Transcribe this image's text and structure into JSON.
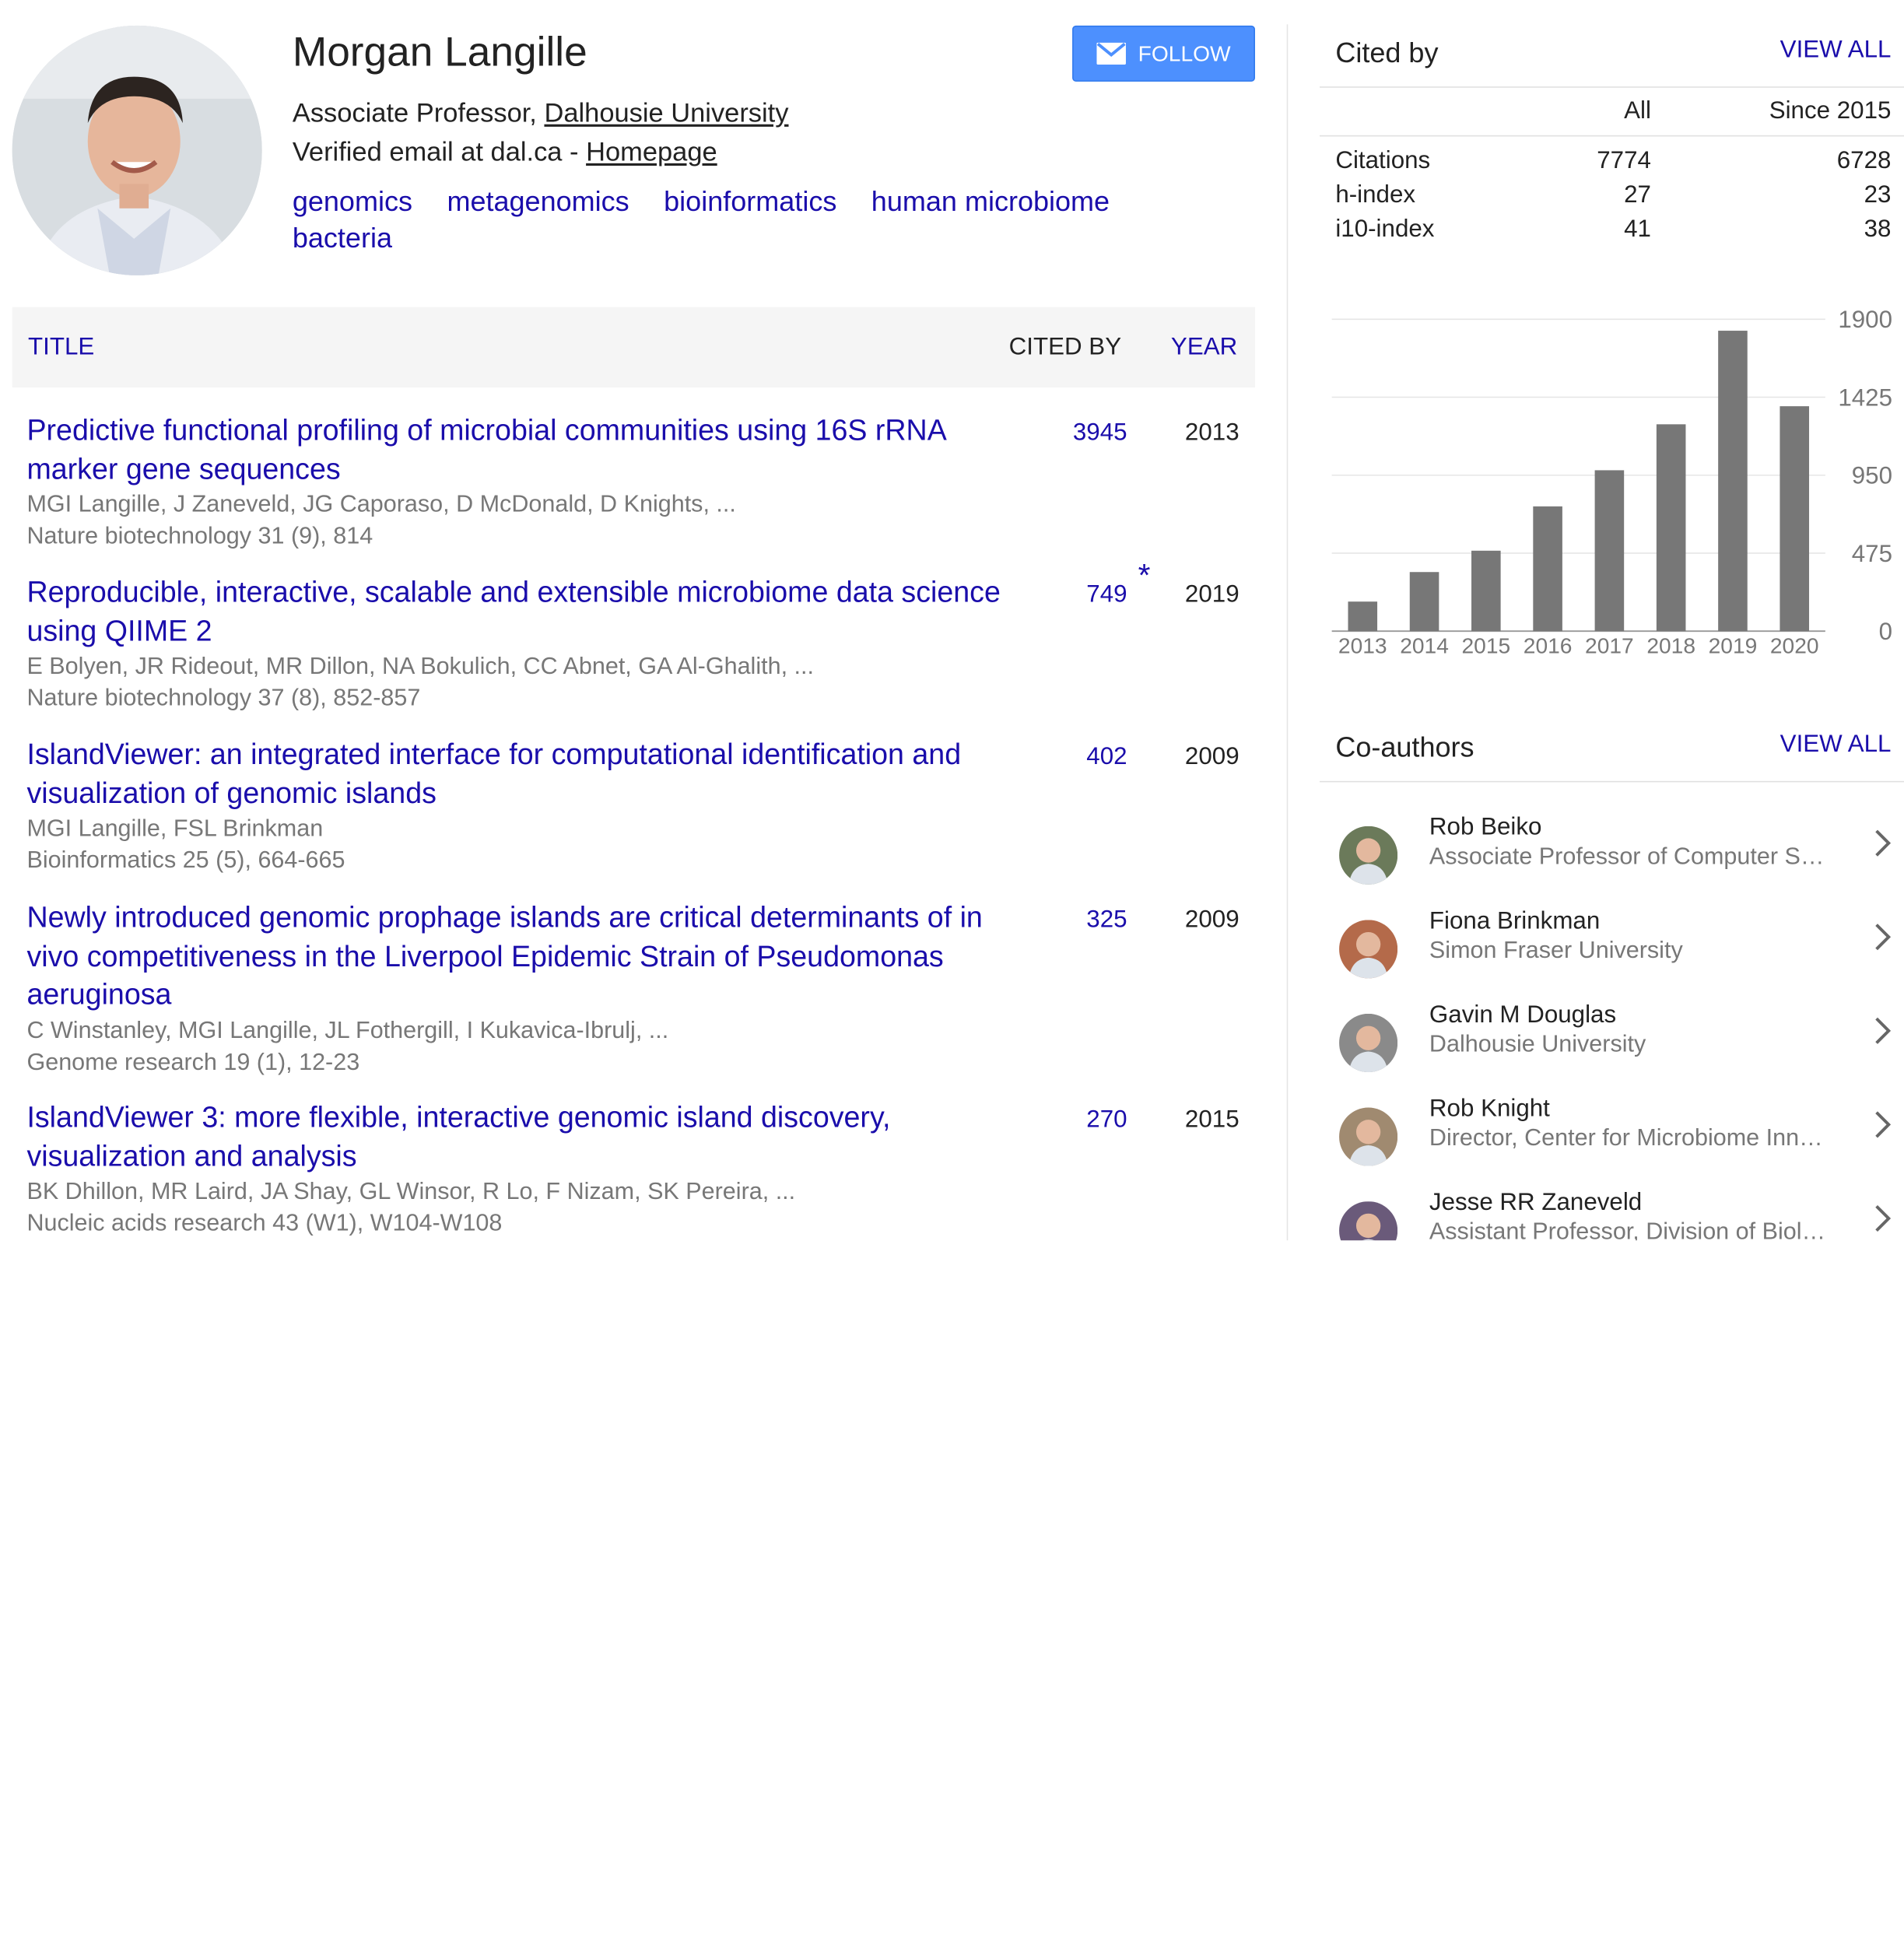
{
  "profile": {
    "name": "Morgan Langille",
    "position": "Associate Professor, ",
    "university": "Dalhousie University",
    "email_text": "Verified email at dal.ca - ",
    "homepage": "Homepage",
    "interests": [
      "genomics",
      "metagenomics",
      "bioinformatics",
      "human microbiome",
      "bacteria"
    ],
    "follow_label": "FOLLOW",
    "avatar_icon": "person-photo-icon"
  },
  "table": {
    "headers": {
      "title": "TITLE",
      "cited_by": "CITED BY",
      "year": "YEAR"
    },
    "rows": [
      {
        "title": "Predictive functional profiling of microbial communities using 16S rRNA marker gene sequences",
        "authors": "MGI Langille, J Zaneveld, JG Caporaso, D McDonald, D Knights, ...",
        "venue": "Nature biotechnology 31 (9), 814",
        "cited": "3945",
        "star": "",
        "year": "2013"
      },
      {
        "title": "Reproducible, interactive, scalable and extensible microbiome data science using QIIME 2",
        "authors": "E Bolyen, JR Rideout, MR Dillon, NA Bokulich, CC Abnet, GA Al-Ghalith, ...",
        "venue": "Nature biotechnology 37 (8), 852-857",
        "cited": "749",
        "star": "*",
        "year": "2019"
      },
      {
        "title": "IslandViewer: an integrated interface for computational identification and visualization of genomic islands",
        "authors": "MGI Langille, FSL Brinkman",
        "venue": "Bioinformatics 25 (5), 664-665",
        "cited": "402",
        "star": "",
        "year": "2009"
      },
      {
        "title": "Newly introduced genomic prophage islands are critical determinants of in vivo competitiveness in the Liverpool Epidemic Strain of Pseudomonas aeruginosa",
        "authors": "C Winstanley, MGI Langille, JL Fothergill, I Kukavica-Ibrulj, ...",
        "venue": "Genome research 19 (1), 12-23",
        "cited": "325",
        "star": "",
        "year": "2009"
      },
      {
        "title": "IslandViewer 3: more flexible, interactive genomic island discovery, visualization and analysis",
        "authors": "BK Dhillon, MR Laird, JA Shay, GL Winsor, R Lo, F Nizam, SK Pereira, ...",
        "venue": "Nucleic acids research 43 (W1), W104-W108",
        "cited": "270",
        "star": "",
        "year": "2015"
      }
    ]
  },
  "cited_by": {
    "title": "Cited by",
    "view_all": "VIEW ALL",
    "col_all": "All",
    "col_since": "Since 2015",
    "rows": [
      {
        "label": "Citations",
        "all": "7774",
        "since": "6728"
      },
      {
        "label": "h-index",
        "all": "27",
        "since": "23"
      },
      {
        "label": "i10-index",
        "all": "41",
        "since": "38"
      }
    ]
  },
  "chart_data": {
    "type": "bar",
    "categories": [
      "2013",
      "2014",
      "2015",
      "2016",
      "2017",
      "2018",
      "2019",
      "2020"
    ],
    "values": [
      180,
      360,
      490,
      760,
      980,
      1260,
      1830,
      1370
    ],
    "y_ticks": [
      "0",
      "475",
      "950",
      "1425",
      "1900"
    ],
    "ylim": [
      0,
      1900
    ],
    "bar_color": "#777777",
    "grid": true
  },
  "coauthors": {
    "title": "Co-authors",
    "view_all": "VIEW ALL",
    "items": [
      {
        "name": "Rob Beiko",
        "affiliation": "Associate Professor of Computer Science",
        "avatar_color": "#6b7a5a"
      },
      {
        "name": "Fiona Brinkman",
        "affiliation": "Simon Fraser University",
        "avatar_color": "#b46a4a"
      },
      {
        "name": "Gavin M Douglas",
        "affiliation": "Dalhousie University",
        "avatar_color": "#8a8a8a"
      },
      {
        "name": "Rob Knight",
        "affiliation": "Director, Center for Microbiome Innovation",
        "avatar_color": "#a08a70"
      },
      {
        "name": "Jesse RR Zaneveld",
        "affiliation": "Assistant Professor, Division of Biological Sciences",
        "avatar_color": "#6a5a7a"
      }
    ],
    "chevron_icon": "chevron-right-icon"
  }
}
